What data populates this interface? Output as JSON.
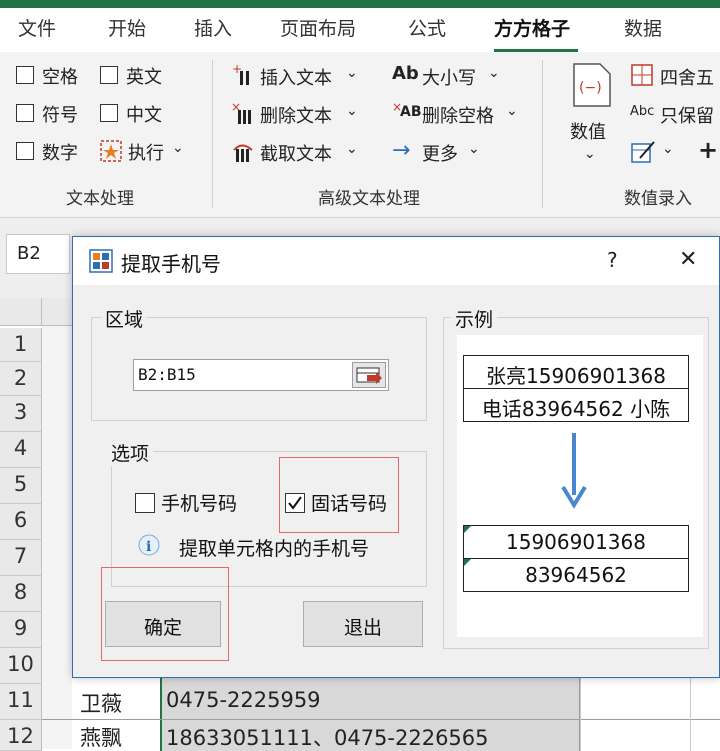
{
  "ribbon": {
    "tabs": [
      "文件",
      "开始",
      "插入",
      "页面布局",
      "公式",
      "方方格子",
      "数据"
    ],
    "text_group": {
      "checkboxes": [
        "空格",
        "英文",
        "符号",
        "中文",
        "数字"
      ],
      "execute": "执行",
      "label": "文本处理"
    },
    "advanced_group": {
      "insert": "插入文本",
      "delete": "删除文本",
      "cut": "截取文本",
      "case": "大小写",
      "delete_space": "删除空格",
      "more": "更多",
      "label": "高级文本处理"
    },
    "value_group": {
      "value": "数值",
      "round": "四舍五",
      "keep": "只保留",
      "label": "数值录入"
    }
  },
  "namebox": "B2",
  "grid": {
    "rows": [
      "1",
      "2",
      "3",
      "4",
      "5",
      "6",
      "7",
      "8",
      "9",
      "10",
      "11",
      "12"
    ],
    "row11": {
      "name": "卫薇",
      "value": "0475-2225959"
    },
    "row12": {
      "name": "燕飘",
      "value": "18633051111、0475-2226565"
    }
  },
  "dialog": {
    "title": "提取手机号",
    "help": "?",
    "close": "✕",
    "area_label": "区域",
    "range_value": "B2:B15",
    "options_label": "选项",
    "option_mobile": "手机号码",
    "option_landline": "固话号码",
    "info": "提取单元格内的手机号",
    "ok": "确定",
    "exit": "退出",
    "example_label": "示例",
    "example_inputs": [
      "张亮15906901368",
      "电话83964562 小陈"
    ],
    "example_outputs": [
      "15906901368",
      "83964562"
    ],
    "mobile_checked": false,
    "landline_checked": true
  },
  "colors": {
    "excel_green": "#217346",
    "dialog_border": "#2f6db0",
    "highlight_red": "#e06a6a",
    "arrow_blue": "#4a86cf"
  }
}
